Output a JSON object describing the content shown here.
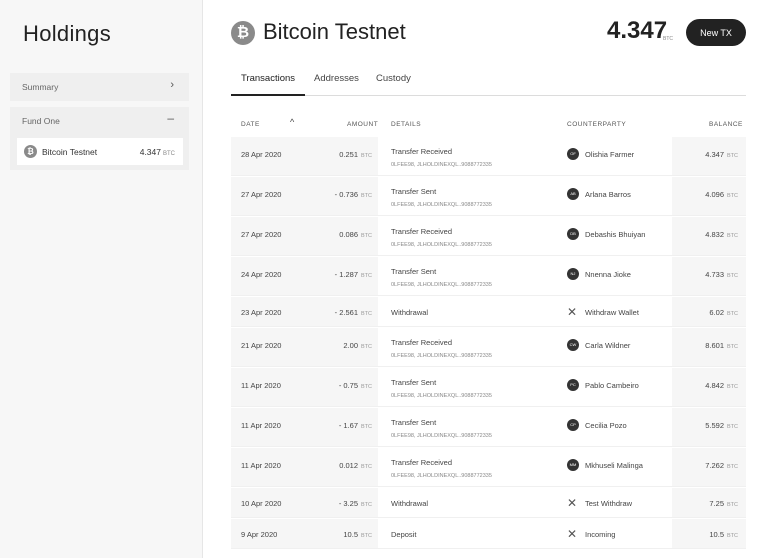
{
  "sidebar": {
    "title": "Holdings",
    "summary_label": "Summary",
    "fund_label": "Fund One",
    "wallet": {
      "name": "Bitcoin Testnet",
      "amount": "4.347",
      "unit": "BTC"
    }
  },
  "header": {
    "title": "Bitcoin Testnet",
    "balance": "4.347",
    "balance_unit": "BTC",
    "new_tx_label": "New TX"
  },
  "tabs": [
    {
      "label": "Transactions",
      "active": true
    },
    {
      "label": "Addresses",
      "active": false
    },
    {
      "label": "Custody",
      "active": false
    }
  ],
  "table": {
    "columns": [
      "DATE",
      "AMOUNT",
      "DETAILS",
      "COUNTERPARTY",
      "BALANCE"
    ],
    "unit": "BTC",
    "rows": [
      {
        "date": "28 Apr 2020",
        "amount": "0.251",
        "details": "Transfer Received",
        "sub": "0LFEE98, JLHOLDINEXQL..9088772335",
        "counterparty": "Olishia Farmer",
        "initials": "OF",
        "balance": "4.347",
        "avatar": true
      },
      {
        "date": "27 Apr 2020",
        "amount": "- 0.736",
        "details": "Transfer Sent",
        "sub": "0LFEE98, JLHOLDINEXQL..9088772335",
        "counterparty": "Arlana Barros",
        "initials": "AB",
        "balance": "4.096",
        "avatar": true
      },
      {
        "date": "27 Apr 2020",
        "amount": "0.086",
        "details": "Transfer Received",
        "sub": "0LFEE98, JLHOLDINEXQL..9088772335",
        "counterparty": "Debashis Bhuiyan",
        "initials": "DB",
        "balance": "4.832",
        "avatar": true
      },
      {
        "date": "24 Apr 2020",
        "amount": "- 1.287",
        "details": "Transfer Sent",
        "sub": "0LFEE98, JLHOLDINEXQL..9088772335",
        "counterparty": "Nnenna Jioke",
        "initials": "NJ",
        "balance": "4.733",
        "avatar": true
      },
      {
        "date": "23 Apr 2020",
        "amount": "- 2.561",
        "details": "Withdrawal",
        "sub": "",
        "counterparty": "Withdraw Wallet",
        "initials": "",
        "balance": "6.02",
        "avatar": false
      },
      {
        "date": "21 Apr 2020",
        "amount": "2.00",
        "details": "Transfer Received",
        "sub": "0LFEE98, JLHOLDINEXQL..9088772335",
        "counterparty": "Carla Wildner",
        "initials": "CW",
        "balance": "8.601",
        "avatar": true
      },
      {
        "date": "11 Apr 2020",
        "amount": "- 0.75",
        "details": "Transfer Sent",
        "sub": "0LFEE98, JLHOLDINEXQL..9088772335",
        "counterparty": "Pablo Cambeiro",
        "initials": "PC",
        "balance": "4.842",
        "avatar": true
      },
      {
        "date": "11 Apr 2020",
        "amount": "- 1.67",
        "details": "Transfer Sent",
        "sub": "0LFEE98, JLHOLDINEXQL..9088772335",
        "counterparty": "Cecilia Pozo",
        "initials": "CP",
        "balance": "5.592",
        "avatar": true
      },
      {
        "date": "11 Apr 2020",
        "amount": "0.012",
        "details": "Transfer Received",
        "sub": "0LFEE98, JLHOLDINEXQL..9088772335",
        "counterparty": "Mkhuseli Malinga",
        "initials": "MM",
        "balance": "7.262",
        "avatar": true
      },
      {
        "date": "10 Apr 2020",
        "amount": "- 3.25",
        "details": "Withdrawal",
        "sub": "",
        "counterparty": "Test Withdraw",
        "initials": "",
        "balance": "7.25",
        "avatar": false
      },
      {
        "date": "9 Apr 2020",
        "amount": "10.5",
        "details": "Deposit",
        "sub": "",
        "counterparty": "Incoming",
        "initials": "",
        "balance": "10.5",
        "avatar": false
      }
    ]
  }
}
